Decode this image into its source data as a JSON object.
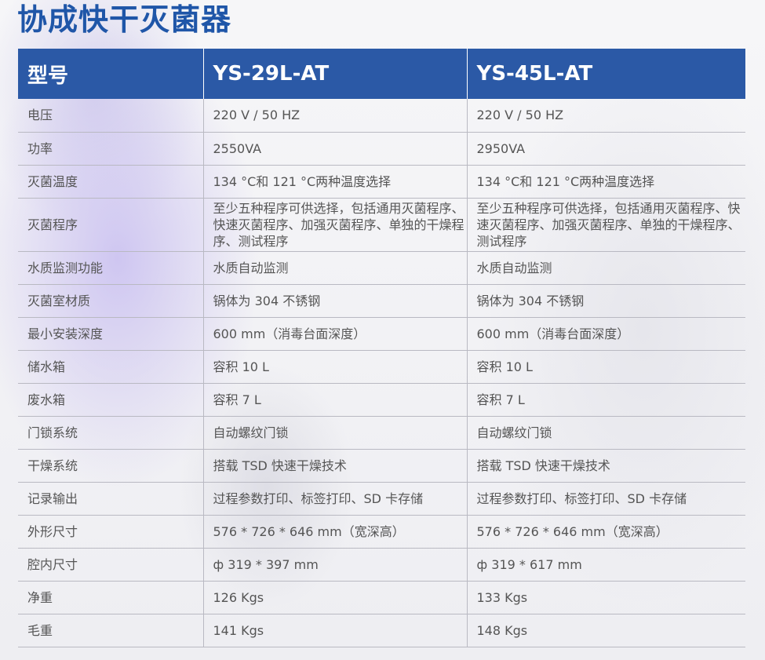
{
  "title": "协成快干灭菌器",
  "table": {
    "headers": [
      "型号",
      "YS-29L-AT",
      "YS-45L-AT"
    ],
    "rows": [
      [
        "电压",
        "220 V / 50 HZ",
        "220 V / 50 HZ"
      ],
      [
        "功率",
        "2550VA",
        "2950VA"
      ],
      [
        "灭菌温度",
        "134 °C和 121 °C两种温度选择",
        "134 °C和 121 °C两种温度选择"
      ],
      [
        "灭菌程序",
        "至少五种程序可供选择，包括通用灭菌程序、快速灭菌程序、加强灭菌程序、单独的干燥程序、测试程序",
        "至少五种程序可供选择，包括通用灭菌程序、快速灭菌程序、加强灭菌程序、单独的干燥程序、测试程序"
      ],
      [
        "水质监测功能",
        "水质自动监测",
        "水质自动监测"
      ],
      [
        "灭菌室材质",
        "锅体为 304 不锈钢",
        "锅体为 304 不锈钢"
      ],
      [
        "最小安装深度",
        "600 mm（消毒台面深度）",
        "600 mm（消毒台面深度）"
      ],
      [
        "储水箱",
        "容积 10 L",
        "容积 10 L"
      ],
      [
        "废水箱",
        "容积 7 L",
        "容积 7 L"
      ],
      [
        "门锁系统",
        "自动螺纹门锁",
        "自动螺纹门锁"
      ],
      [
        "干燥系统",
        "搭载 TSD 快速干燥技术",
        "搭载 TSD 快速干燥技术"
      ],
      [
        "记录输出",
        "过程参数打印、标签打印、SD 卡存储",
        "过程参数打印、标签打印、SD 卡存储"
      ],
      [
        "外形尺寸",
        "576 * 726 * 646 mm（宽深高）",
        "576 * 726 * 646 mm（宽深高）"
      ],
      [
        "腔内尺寸",
        "ф 319 * 397 mm",
        "ф 319 * 617 mm"
      ],
      [
        "净重",
        "126 Kgs",
        "133 Kgs"
      ],
      [
        "毛重",
        "141 Kgs",
        "148 Kgs"
      ]
    ]
  },
  "colors": {
    "title": "#1f56a8",
    "header_bg": "#2b59a6",
    "header_text": "#ffffff",
    "body_text": "#555555",
    "rule": "#b9b9c2"
  }
}
